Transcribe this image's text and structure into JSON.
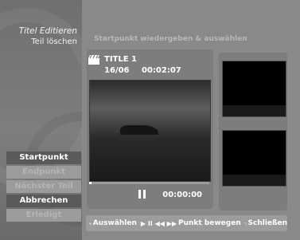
{
  "sidebar": {
    "title": "Titel Editieren",
    "subtitle": "Teil löschen",
    "menu": [
      {
        "label": "Startpunkt",
        "state": "active"
      },
      {
        "label": "Endpunkt",
        "state": "disabled"
      },
      {
        "label": "Nächster Teil",
        "state": "disabled"
      },
      {
        "label": "Abbrechen",
        "state": "enabled"
      },
      {
        "label": "Erledigt",
        "state": "disabled"
      }
    ]
  },
  "main": {
    "instruction": "Startpunkt wiedergeben & auswählen",
    "title": {
      "icon": "clapperboard-icon",
      "name": "TITLE 1",
      "date": "16/06",
      "duration": "00:02:07"
    },
    "player": {
      "state_icon": "pause-icon",
      "counter": "00:00:00",
      "progress": 0.02
    }
  },
  "footer": {
    "select_icon": "ok-circle-icon",
    "select_label": "Auswählen",
    "move_icons": "▶ II ◀◀ ▶▶",
    "move_label": "Punkt bewegen",
    "close_icon": "return-icon",
    "close_label": "Schließen"
  }
}
